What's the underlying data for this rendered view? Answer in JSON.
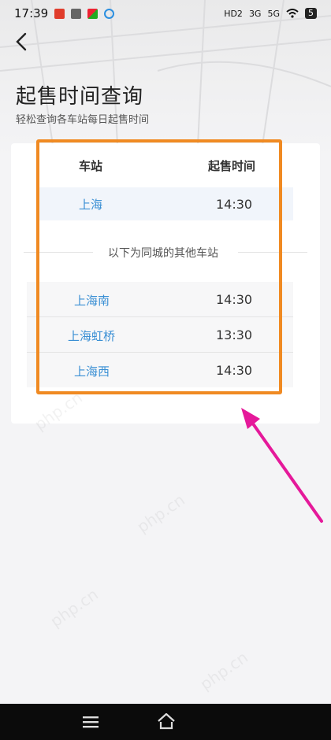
{
  "status_bar": {
    "time": "17:39",
    "network_1": "HD2",
    "network_2": "3G",
    "network_3": "5G",
    "battery": "5"
  },
  "header": {
    "title": "起售时间查询",
    "subtitle": "轻松查询各车站每日起售时间"
  },
  "table": {
    "col_station": "车站",
    "col_time": "起售时间",
    "main_station": {
      "station": "上海",
      "time": "14:30"
    },
    "divider_text": "以下为同城的其他车站",
    "other_stations": [
      {
        "station": "上海南",
        "time": "14:30"
      },
      {
        "station": "上海虹桥",
        "time": "13:30"
      },
      {
        "station": "上海西",
        "time": "14:30"
      }
    ]
  },
  "colors": {
    "accent_blue": "#3a8fd4",
    "highlight_orange": "#f08a22",
    "arrow_pink": "#e5199a"
  },
  "icons": {
    "back": "chevron-left-icon",
    "menu": "hamburger-icon",
    "home": "home-icon"
  }
}
